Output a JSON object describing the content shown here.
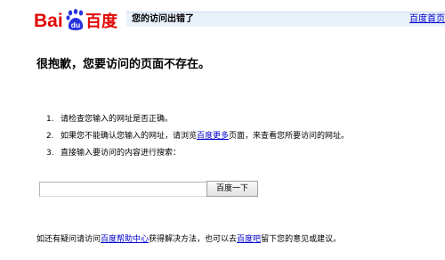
{
  "header": {
    "logo": {
      "left_text": "Bai",
      "paw_text": "du",
      "right_text": "百度",
      "colors": {
        "red": "#e10602",
        "blue": "#2932e1"
      }
    },
    "title": "您的访问出错了",
    "home_link": "百度首页"
  },
  "headline": "很抱歉，您要访问的页面不存在。",
  "tips": [
    {
      "num": "1.",
      "text": "请检查您输入的网址是否正确。"
    },
    {
      "num": "2.",
      "before": "如果您不能确认您输入的网址，请浏览",
      "link": "百度更多",
      "after": "页面，来查看您所要访问的网址。"
    },
    {
      "num": "3.",
      "text": "直接输入要访问的内容进行搜索："
    }
  ],
  "search": {
    "value": "",
    "button_label": "百度一下"
  },
  "footer": {
    "before": "如还有疑问请访问",
    "link1": "百度帮助中心",
    "middle": "获得解决方法，也可以去",
    "link2": "百度吧",
    "after": "留下您的意见或建议。"
  },
  "colors": {
    "link": "#0000cc",
    "title_bar_bg": "#e9f1fb",
    "title_bar_border": "#c9d7f1"
  }
}
